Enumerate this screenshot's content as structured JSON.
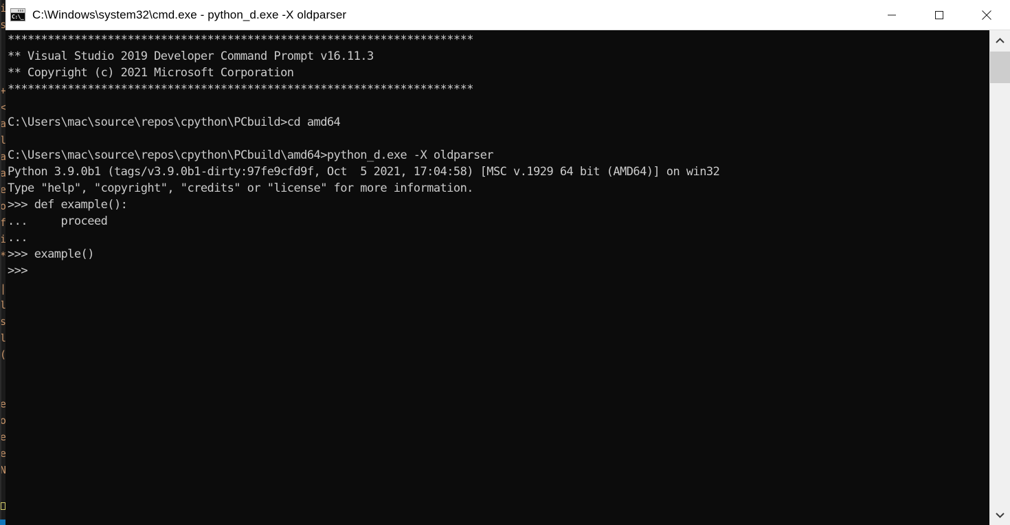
{
  "window": {
    "title": "C:\\Windows\\system32\\cmd.exe - python_d.exe  -X oldparser",
    "icon_name": "cmd-console-icon",
    "icon_glyph": "C:\\_",
    "titlebar_bg": "#ffffff",
    "title_color": "#000000",
    "controls": {
      "minimize_label": "Minimize",
      "maximize_label": "Maximize",
      "close_label": "Close"
    }
  },
  "console": {
    "background": "#0c0c0c",
    "foreground": "#cccccc",
    "lines": [
      "**********************************************************************",
      "** Visual Studio 2019 Developer Command Prompt v16.11.3",
      "** Copyright (c) 2021 Microsoft Corporation",
      "**********************************************************************",
      "",
      "C:\\Users\\mac\\source\\repos\\cpython\\PCbuild>cd amd64",
      "",
      "C:\\Users\\mac\\source\\repos\\cpython\\PCbuild\\amd64>python_d.exe -X oldparser",
      "Python 3.9.0b1 (tags/v3.9.0b1-dirty:97fe9cfd9f, Oct  5 2021, 17:04:58) [MSC v.1929 64 bit (AMD64)] on win32",
      "Type \"help\", \"copyright\", \"credits\" or \"license\" for more information.",
      ">>> def example():",
      "...     proceed",
      "...",
      ">>> example()",
      ">>>"
    ]
  },
  "scrollbar": {
    "up_arrow_name": "chevron-up-icon",
    "down_arrow_name": "chevron-down-icon",
    "track_color": "#f0f0f0",
    "thumb_color": "#cdcdcd"
  },
  "background_window": {
    "strip_color": "#1b1b1b",
    "text_color": "#c8956a",
    "accent_color": "#1177bb",
    "highlight_color": "#d6cf6a",
    "fragments": [
      "i",
      "s",
      " ",
      " ",
      " ",
      "+",
      "<",
      "a",
      "l",
      "a",
      "a",
      "e",
      "o",
      "f",
      "i",
      "*",
      " ",
      "|",
      "l",
      "s",
      "l",
      "(",
      " ",
      " ",
      "e",
      "o",
      "e",
      "e",
      "N",
      " ",
      " "
    ]
  }
}
